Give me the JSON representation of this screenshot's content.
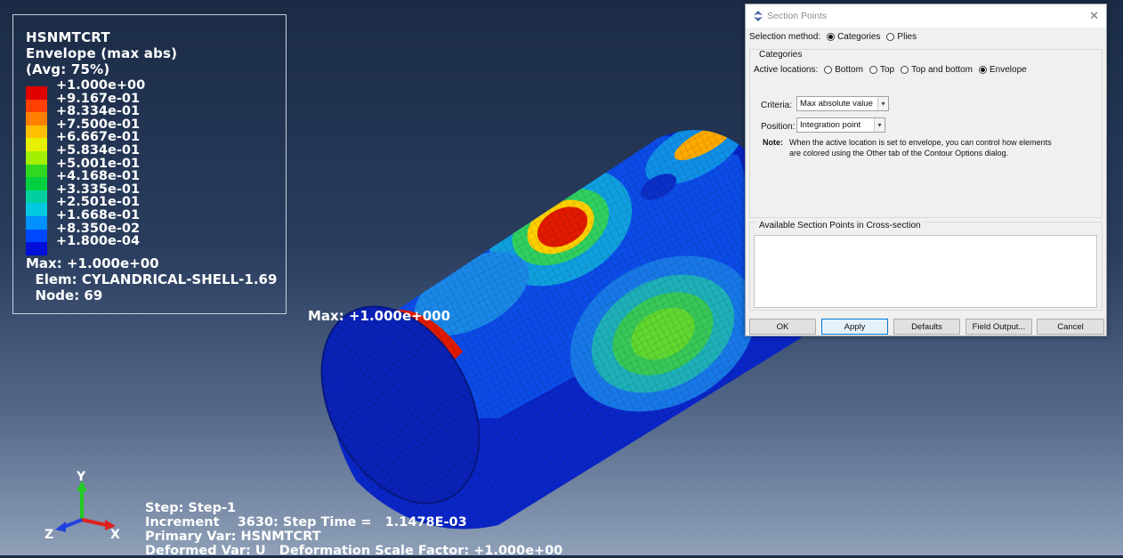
{
  "legend": {
    "title_lines": [
      "HSNMTCRT",
      "Envelope (max abs)",
      "(Avg: 75%)"
    ],
    "colors": [
      "#e00000",
      "#ff4000",
      "#ff8000",
      "#ffbf00",
      "#e6f000",
      "#a0f000",
      "#30d820",
      "#00d040",
      "#00d0a0",
      "#00c8e0",
      "#0090ff",
      "#0048ff",
      "#0010d8"
    ],
    "ticks": [
      "+1.000e+00",
      "+9.167e-01",
      "+8.334e-01",
      "+7.500e-01",
      "+6.667e-01",
      "+5.834e-01",
      "+5.001e-01",
      "+4.168e-01",
      "+3.335e-01",
      "+2.501e-01",
      "+1.668e-01",
      "+8.350e-02",
      "+1.800e-04"
    ],
    "max_lines": [
      "Max: +1.000e+00",
      "  Elem: CYLANDRICAL-SHELL-1.69",
      "  Node: 69"
    ]
  },
  "model": {
    "max_label": "Max: +1.000e+000"
  },
  "triad": {
    "x": "X",
    "y": "Y",
    "z": "Z"
  },
  "step_info": {
    "line1": "Step: Step-1",
    "line2": "Increment    3630: Step Time =   1.1478E-03",
    "line3": "Primary Var: HSNMTCRT",
    "line4": "Deformed Var: U   Deformation Scale Factor: +1.000e+00"
  },
  "dialog": {
    "title": "Section Points",
    "selection_method_label": "Selection method:",
    "selection_options": [
      "Categories",
      "Plies"
    ],
    "selection_selected": "Categories",
    "categories_title": "Categories",
    "active_locations_label": "Active locations:",
    "location_options": [
      "Bottom",
      "Top",
      "Top and bottom",
      "Envelope"
    ],
    "location_selected": "Envelope",
    "criteria_label": "Criteria:",
    "criteria_value": "Max absolute value",
    "position_label": "Position:",
    "position_value": "Integration point",
    "note_label": "Note:",
    "note_text_line1": "When the active location is set to envelope, you can control how elements",
    "note_text_line2": "are colored using the Other tab of the Contour Options dialog.",
    "available_title": "Available Section Points in Cross-section",
    "buttons": {
      "ok": "OK",
      "apply": "Apply",
      "defaults": "Defaults",
      "field_output": "Field Output...",
      "cancel": "Cancel"
    }
  }
}
